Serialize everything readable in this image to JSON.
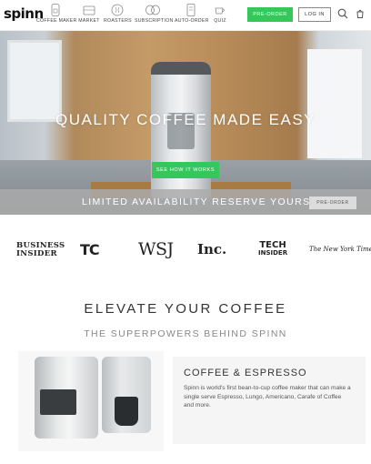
{
  "brand": {
    "logo_text": "spinn",
    "accent_green": "#34c759"
  },
  "nav": {
    "items": [
      {
        "label": "COFFEE MAKER",
        "icon": "coffee-maker-icon"
      },
      {
        "label": "MARKET",
        "icon": "market-icon"
      },
      {
        "label": "ROASTERS",
        "icon": "roasters-icon"
      },
      {
        "label": "SUBSCRIPTION",
        "icon": "subscription-icon"
      },
      {
        "label": "AUTO-ORDER",
        "icon": "auto-order-icon"
      },
      {
        "label": "QUIZ",
        "icon": "quiz-icon"
      }
    ],
    "preorder_label": "PRE-ORDER",
    "login_label": "LOG IN"
  },
  "hero": {
    "title": "QUALITY COFFEE MADE EASY",
    "cta_label": "SEE HOW IT WORKS"
  },
  "promo_band": {
    "text": "LIMITED AVAILABILITY RESERVE YOURS",
    "button_label": "PRE-ORDER"
  },
  "press": {
    "logos": [
      "BUSINESS INSIDER",
      "TC",
      "WSJ",
      "Inc.",
      "TECH INSIDER",
      "The New York Times"
    ],
    "business_insider_line1": "BUSINESS",
    "business_insider_line2": "INSIDER",
    "tech_insider_line1": "TECH",
    "tech_insider_line2": "INSIDER"
  },
  "section": {
    "heading": "ELEVATE YOUR COFFEE",
    "subheading": "THE SUPERPOWERS BEHIND SPINN"
  },
  "feature": {
    "title": "COFFEE & ESPRESSO",
    "body": "Spinn is world's first bean-to-cup coffee maker that can make a single serve Espresso, Lungo, Americano, Carafe of Coffee and more."
  }
}
